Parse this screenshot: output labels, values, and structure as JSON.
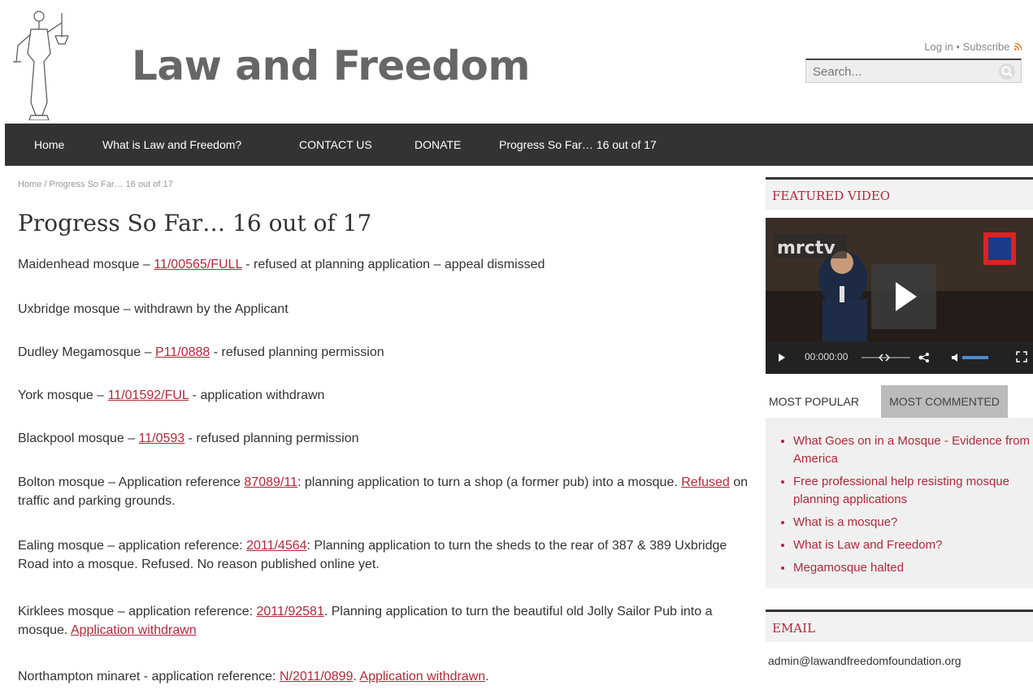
{
  "site": {
    "title": "Law and Freedom",
    "logo_name": "scales-of-justice-statue"
  },
  "toplinks": {
    "login": "Log in",
    "separator": "•",
    "subscribe": "Subscribe",
    "rss_icon": "rss-icon"
  },
  "search": {
    "placeholder": "Search..."
  },
  "nav": {
    "items": [
      "Home",
      "What is Law and Freedom?",
      "CONTACT US",
      "DONATE",
      "Progress So Far… 16 out of 17"
    ]
  },
  "breadcrumb": "Home / Progress So Far… 16 out of 17",
  "page_title": "Progress So Far… 16 out of 17",
  "entries": [
    {
      "pre": "Maidenhead mosque – ",
      "link1": "11/00565/FULL",
      "mid": " - refused at planning application – appeal dismissed",
      "link2": "",
      "post": ""
    },
    {
      "pre": "Uxbridge mosque – withdrawn by the Applicant",
      "link1": "",
      "mid": "",
      "link2": "",
      "post": ""
    },
    {
      "pre": "Dudley Megamosque – ",
      "link1": "P11/0888",
      "mid": " - refused planning permission",
      "link2": "",
      "post": ""
    },
    {
      "pre": "York mosque –  ",
      "link1": "11/01592/FUL",
      "mid": " - application withdrawn",
      "link2": "",
      "post": ""
    },
    {
      "pre": "Blackpool mosque – ",
      "link1": "11/0593",
      "mid": " - refused planning permission",
      "link2": "",
      "post": ""
    },
    {
      "pre": "Bolton mosque – Application reference ",
      "link1": "87089/11",
      "mid": ": planning application to turn a shop (a former pub) into a mosque. ",
      "link2": "Refused",
      "post": " on traffic and parking grounds."
    },
    {
      "pre": "Ealing mosque – application reference: ",
      "link1": "2011/4564",
      "mid": ": Planning application to turn the sheds to the rear of 387 & 389 Uxbridge Road into a mosque. Refused. No reason published online yet.",
      "link2": "",
      "post": ""
    },
    {
      "pre": "Kirklees mosque – application reference: ",
      "link1": "2011/92581",
      "mid": ". Planning application to turn the beautiful old Jolly Sailor Pub into a mosque. ",
      "link2": "Application withdrawn",
      "post": ""
    },
    {
      "pre": "Northampton minaret -  application reference: ",
      "link1": "N/2011/0899",
      "mid": ". ",
      "link2": "Application withdrawn",
      "post": "."
    }
  ],
  "sidebar": {
    "featured_video": {
      "title": "FEATURED VIDEO",
      "channel_logo": "mrctv",
      "time": "00:000:00"
    },
    "tabs": [
      "MOST POPULAR",
      "MOST COMMENTED"
    ],
    "popular_items": [
      "What Goes on in a Mosque - Evidence from America",
      "Free professional help resisting mosque planning applications",
      "What is a mosque?",
      "What is Law and Freedom?",
      "Megamosque halted"
    ],
    "email": {
      "title": "EMAIL",
      "address": "admin@lawandfreedomfoundation.org"
    }
  },
  "colors": {
    "accent": "#b02a3a",
    "nav_bg": "#333333",
    "title_gray": "#666666"
  }
}
